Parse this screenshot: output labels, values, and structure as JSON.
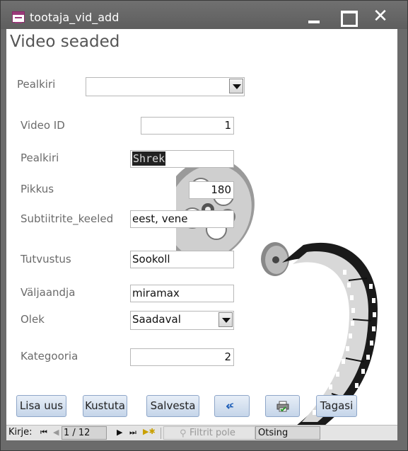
{
  "window": {
    "title": "tootaja_vid_add"
  },
  "form": {
    "title": "Video seaded",
    "combo": {
      "label": "Pealkiri",
      "value": ""
    },
    "fields": {
      "video_id": {
        "label": "Video ID",
        "value": "1"
      },
      "pealkiri": {
        "label": "Pealkiri",
        "value": "Shrek"
      },
      "pikkus": {
        "label": "Pikkus",
        "value": "180"
      },
      "subtiitrid": {
        "label": "Subtiitrite_keeled",
        "value": "eest, vene"
      },
      "tutvustus": {
        "label": "Tutvustus",
        "value": "Sookoll"
      },
      "valjaandja": {
        "label": "Väljaandja",
        "value": "miramax"
      },
      "olek": {
        "label": "Olek",
        "value": "Saadaval"
      },
      "kategooria": {
        "label": "Kategooria",
        "value": "2"
      }
    }
  },
  "buttons": {
    "lisa": "Lisa uus",
    "kustuta": "Kustuta",
    "salvesta": "Salvesta",
    "undo_icon": "undo-icon",
    "print_icon": "print-icon",
    "tagasi": "Tagasi"
  },
  "navigation": {
    "label": "Kirje:",
    "record": "1 / 12",
    "filter": "Filtrit pole",
    "search": "Otsing"
  },
  "colors": {
    "button_bg": "#c5d5e9",
    "selection_bg": "#222222"
  }
}
